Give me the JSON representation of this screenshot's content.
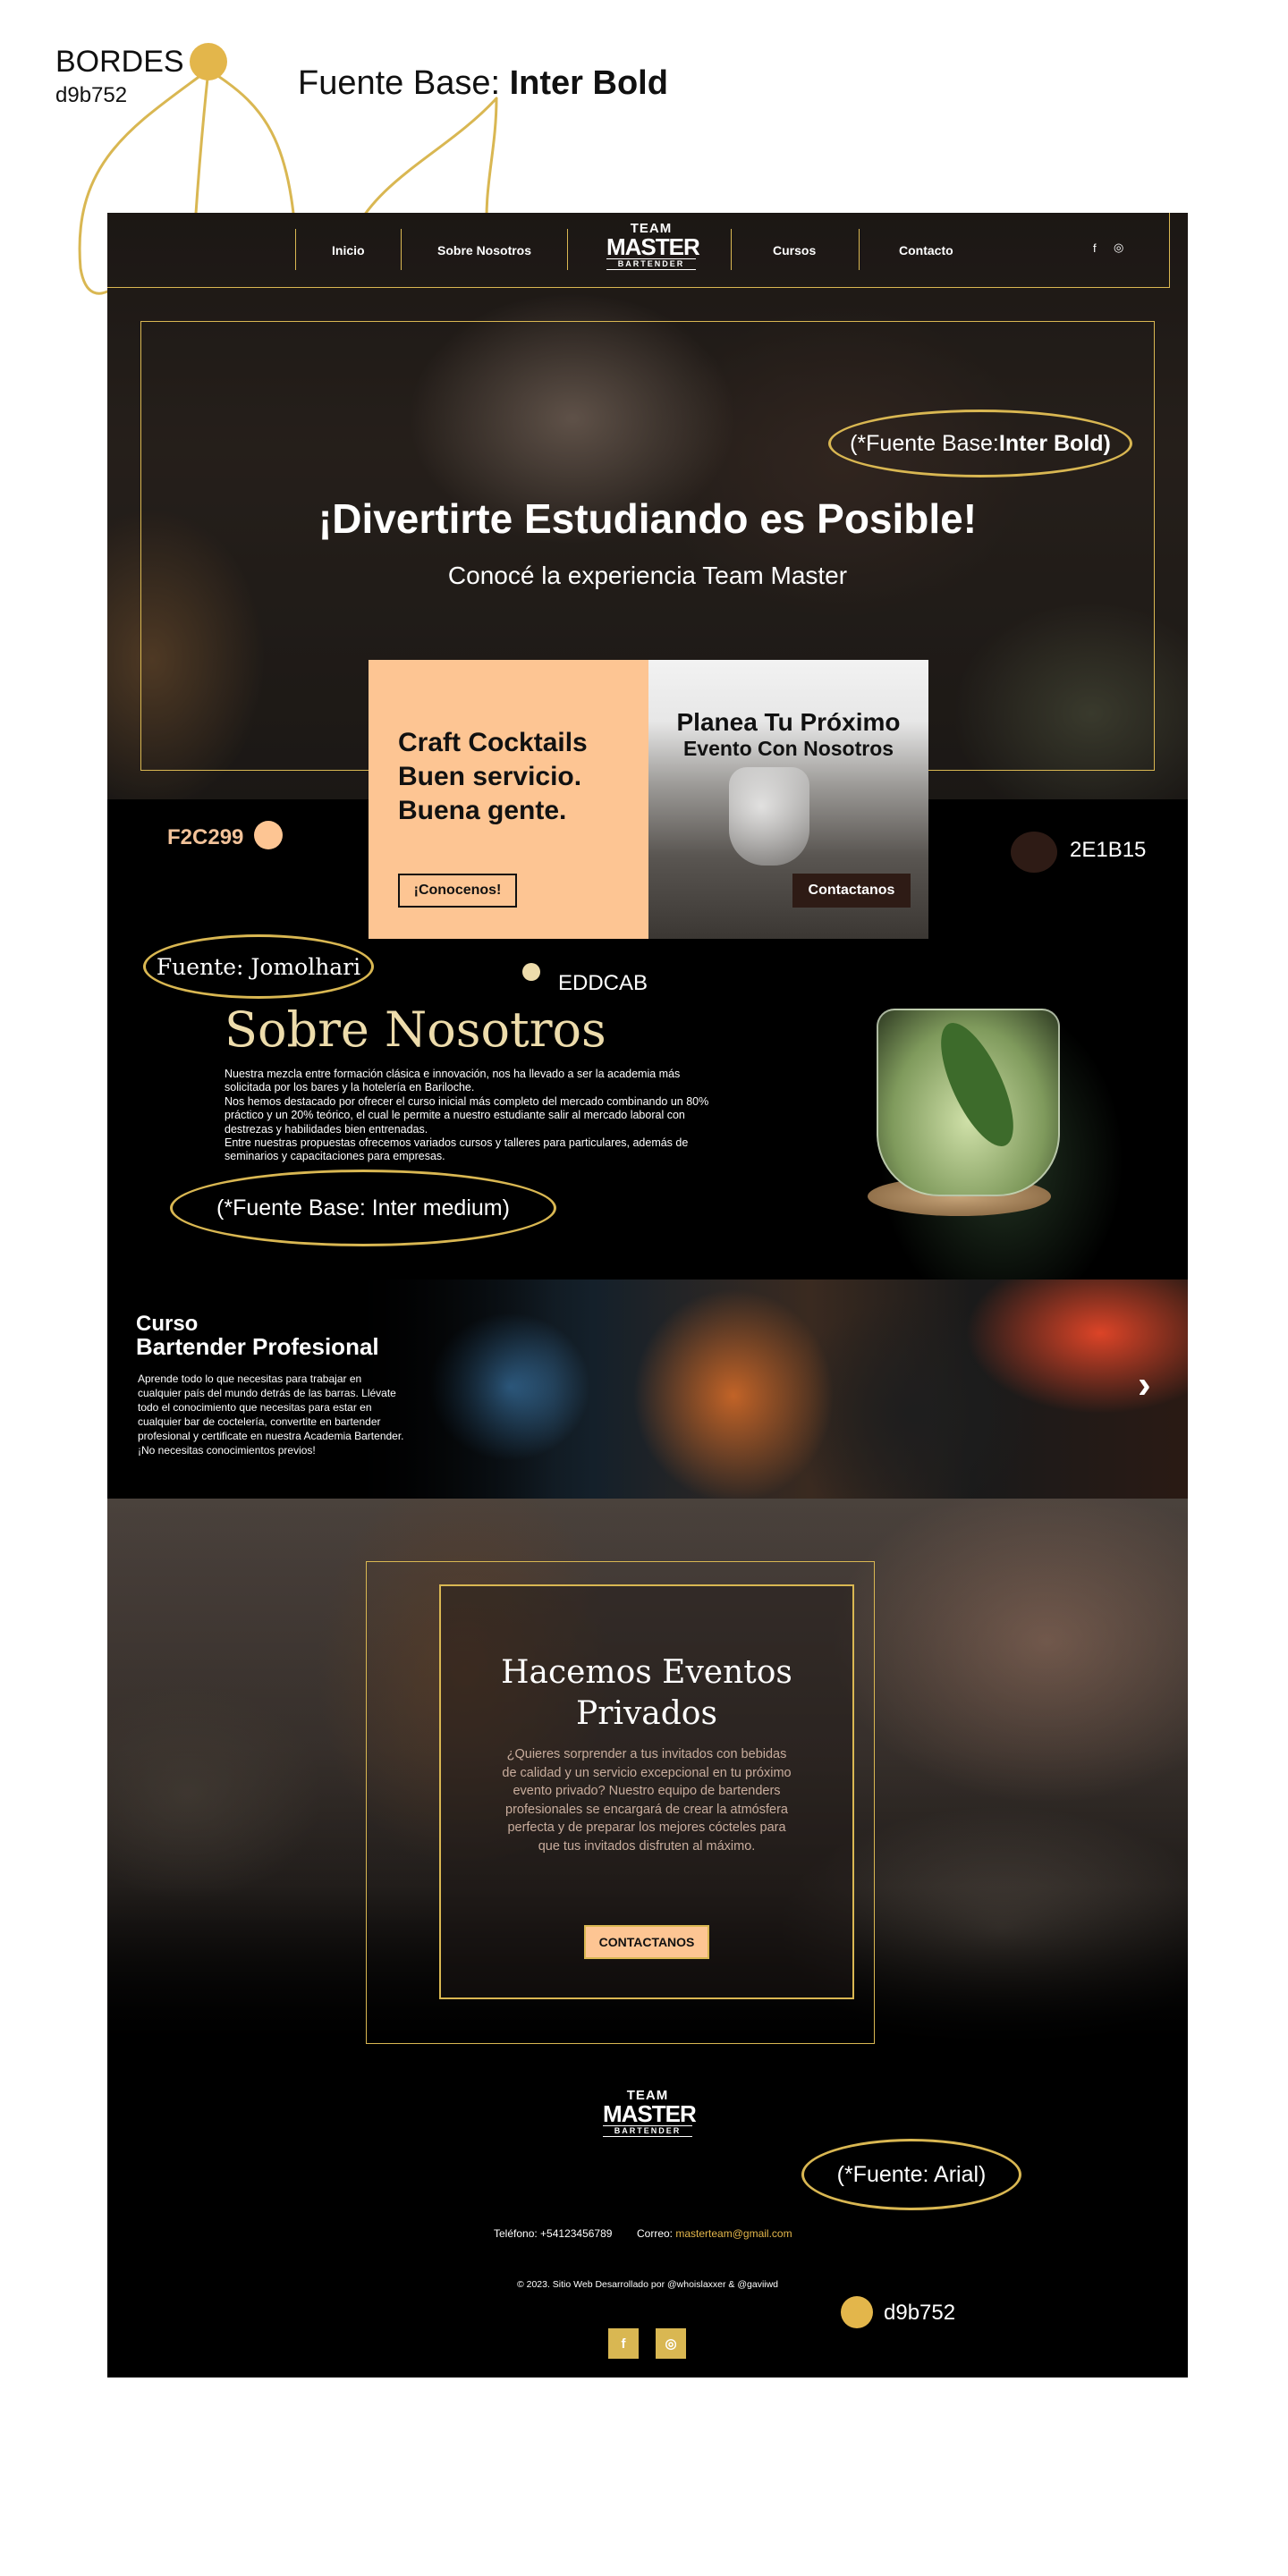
{
  "annotations": {
    "borders_label": "BORDES",
    "borders_hex": "d9b752",
    "font_base_prefix": "Fuente Base:",
    "font_base_name": "Inter Bold",
    "hero_note": "(*Fuente Base: ",
    "hero_note_bold": "Inter Bold)",
    "orange_hex": "F2C299",
    "brown_hex": "2E1B15",
    "jomolhari_note": "Fuente: Jomolhari",
    "cream_hex": "EDDCAB",
    "inter_medium_note": "(*Fuente Base: Inter medium)",
    "arial_note": "(*Fuente: Arial)",
    "footer_hex": "d9b752"
  },
  "colors": {
    "border": "#d9b752",
    "orange": "#fdc593",
    "brown": "#2e1b15",
    "cream": "#eddcab"
  },
  "nav": {
    "items": [
      "Inicio",
      "Sobre Nosotros",
      "Cursos",
      "Contacto"
    ],
    "logo": {
      "top": "TEAM",
      "middle": "MASTER",
      "bottom": "BARTENDER"
    },
    "social": {
      "facebook": "f",
      "instagram": "◎"
    }
  },
  "hero": {
    "title": "¡Divertirte Estudiando es Posible!",
    "subtitle": "Conocé la experiencia Team Master"
  },
  "cards": {
    "left": {
      "lines": [
        "Craft Cocktails",
        "Buen servicio.",
        "Buena gente."
      ],
      "button": "¡Conocenos!"
    },
    "right": {
      "title": "Planea Tu Próximo",
      "subtitle": "Evento Con Nosotros",
      "button": "Contactanos"
    }
  },
  "about": {
    "title": "Sobre Nosotros",
    "paragraphs": [
      "Nuestra mezcla entre formación clásica e innovación, nos ha llevado a ser la academia más solicitada por los bares y la hotelería en Bariloche.",
      "Nos hemos destacado por ofrecer el curso inicial más completo del mercado combinando un 80% práctico y un 20% teórico, el cual le permite a nuestro estudiante salir al mercado laboral con destrezas y habilidades bien entrenadas.",
      "Entre nuestras propuestas ofrecemos variados cursos y talleres para particulares, además de seminarios y capacitaciones para empresas."
    ]
  },
  "course": {
    "label": "Curso",
    "title": "Bartender Profesional",
    "description": "Aprende todo lo que necesitas para trabajar en cualquier país del mundo detrás de las barras. Llévate todo el conocimiento que necesitas para estar en cualquier bar de coctelería, convertite en bartender profesional y certificate en nuestra Academia Bartender. ¡No necesitas conocimientos previos!",
    "next": "›"
  },
  "events": {
    "title": "Hacemos Eventos Privados",
    "text": "¿Quieres sorprender a tus invitados con bebidas de calidad y un servicio excepcional en tu próximo evento privado? Nuestro equipo de bartenders profesionales se encargará de crear la atmósfera perfecta y de preparar los mejores cócteles para que tus invitados disfruten al máximo.",
    "button": "CONTACTANOS"
  },
  "footer": {
    "phone": "Teléfono: +54123456789",
    "mail_label": "Correo: ",
    "mail": "masterteam@gmail.com",
    "copyright": "© 2023. Sitio Web Desarrollado por @whoislaxxer & @gaviiwd"
  }
}
